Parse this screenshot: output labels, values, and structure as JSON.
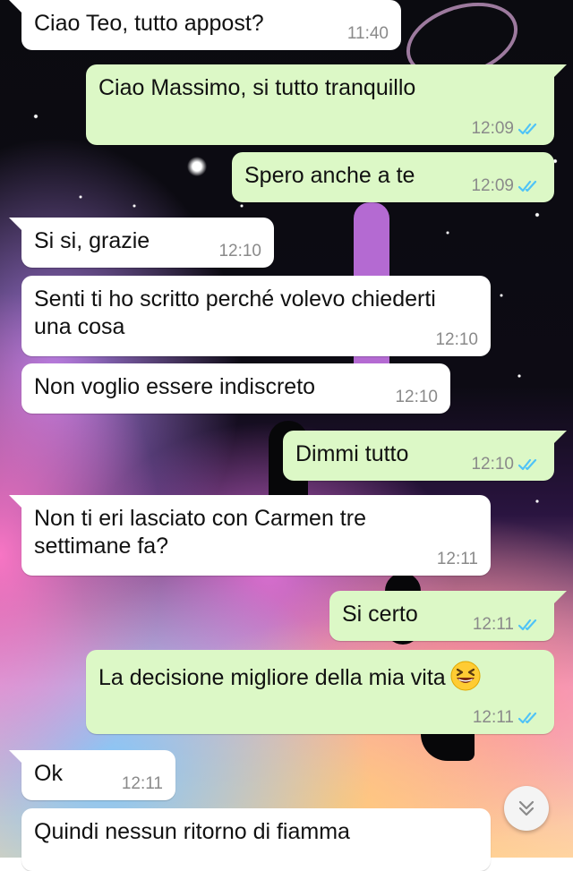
{
  "chat": {
    "messages": [
      {
        "direction": "in",
        "text": "Ciao Teo, tutto appost?",
        "time": "11:40"
      },
      {
        "direction": "out",
        "text": "Ciao Massimo, si tutto tranquillo",
        "time": "12:09",
        "read": true
      },
      {
        "direction": "out",
        "text": "Spero anche a te",
        "time": "12:09",
        "read": true
      },
      {
        "direction": "in",
        "text": "Si si, grazie",
        "time": "12:10"
      },
      {
        "direction": "in",
        "text": "Senti ti ho scritto perché volevo chiederti una cosa",
        "time": "12:10"
      },
      {
        "direction": "in",
        "text": "Non voglio essere indiscreto",
        "time": "12:10"
      },
      {
        "direction": "out",
        "text": "Dimmi tutto",
        "time": "12:10",
        "read": true
      },
      {
        "direction": "in",
        "text": "Non ti eri lasciato con Carmen tre settimane fa?",
        "time": "12:11"
      },
      {
        "direction": "out",
        "text": "Si certo",
        "time": "12:11",
        "read": true
      },
      {
        "direction": "out",
        "text": "La decisione migliore della mia vita",
        "emoji": "grinning-squinting-face",
        "time": "12:11",
        "read": true
      },
      {
        "direction": "in",
        "text": "Ok",
        "time": "12:11"
      },
      {
        "direction": "in",
        "text": "Quindi nessun ritorno di fiamma",
        "time": ""
      }
    ],
    "scroll_to_bottom_icon": "double-chevron-down-icon",
    "read_receipt_icon": "double-check-icon",
    "colors": {
      "incoming_bubble": "#ffffff",
      "outgoing_bubble": "#dcf8c6",
      "read_receipt": "#4fc3f7",
      "timestamp": "#8a8a8a"
    }
  }
}
